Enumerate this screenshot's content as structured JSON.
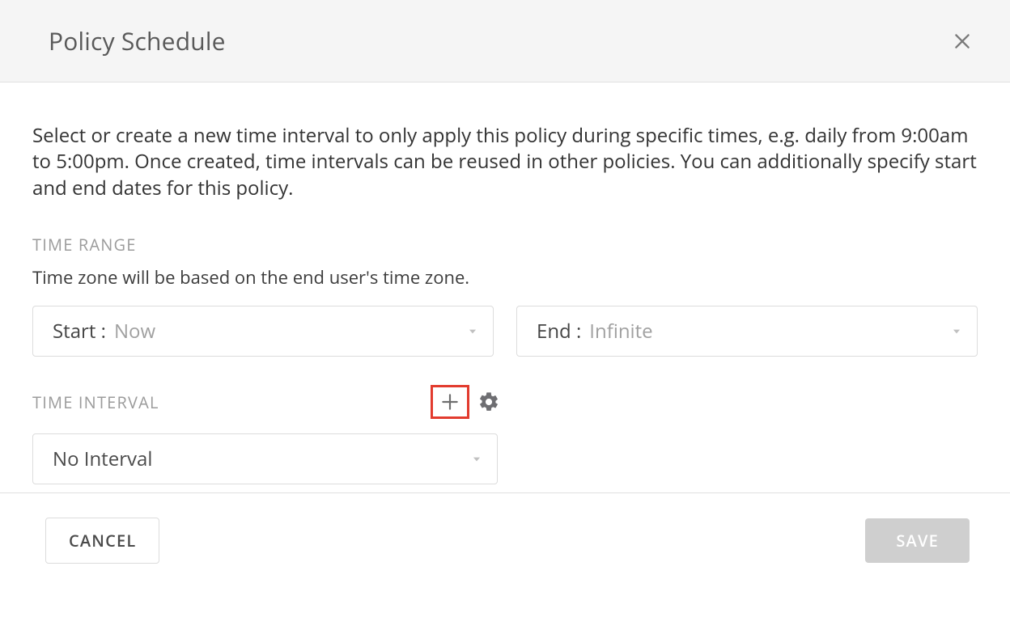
{
  "header": {
    "title": "Policy Schedule"
  },
  "description": "Select or create a new time interval to only apply this policy during specific times, e.g. daily from 9:00am to 5:00pm. Once created, time intervals can be reused in other policies. You can additionally specify start and end dates for this policy.",
  "time_range": {
    "section_label": "TIME RANGE",
    "tz_note": "Time zone will be based on the end user's time zone.",
    "start_label": "Start :",
    "start_value": "Now",
    "end_label": "End :",
    "end_value": "Infinite"
  },
  "time_interval": {
    "section_label": "TIME INTERVAL",
    "selected": "No Interval"
  },
  "footer": {
    "cancel": "CANCEL",
    "save": "SAVE"
  }
}
